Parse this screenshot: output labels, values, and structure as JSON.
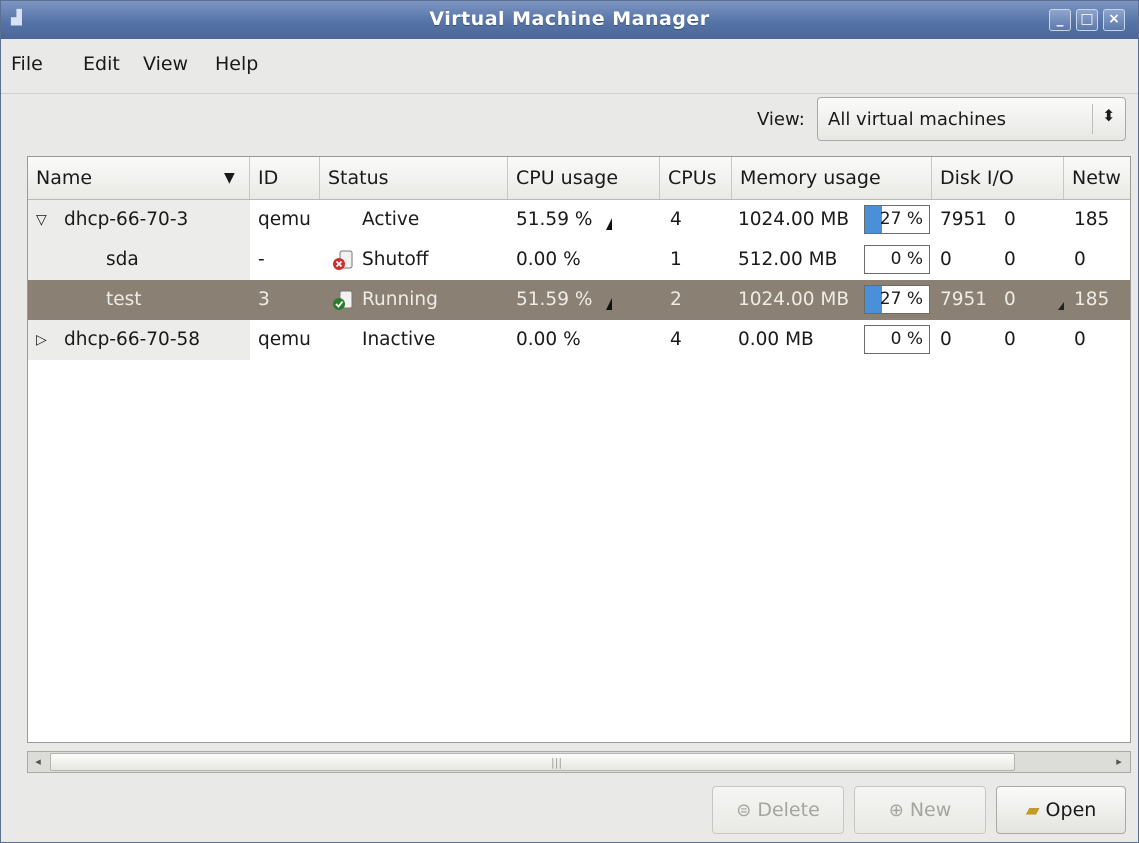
{
  "window": {
    "title": "Virtual Machine Manager",
    "app_icon": "vm-icon",
    "controls": [
      "minimize-icon",
      "maximize-icon",
      "close-icon"
    ]
  },
  "menu": {
    "items": [
      {
        "label": "File"
      },
      {
        "label": "Edit"
      },
      {
        "label": "View"
      },
      {
        "label": "Help"
      }
    ]
  },
  "view_filter": {
    "label": "View:",
    "selected": "All virtual machines",
    "arrow_icon": "up-down-arrows-icon"
  },
  "table": {
    "columns": [
      "Name",
      "ID",
      "Status",
      "CPU usage",
      "CPUs",
      "Memory usage",
      "Disk I/O",
      "Netw"
    ],
    "sort_icon": "sort-down-triangle-icon",
    "rows": [
      {
        "expander": "expanded",
        "name": "dhcp-66-70-3",
        "id": "qemu",
        "status": "Active",
        "status_icon": "",
        "cpu": "51.59 %",
        "cpus": "4",
        "memory": "1024.00 MB",
        "mem_pct_text": "27 %",
        "mem_fill": 0.27,
        "disk_read": "7951",
        "disk_write": "0",
        "net": "185",
        "selected": false
      },
      {
        "expander": "",
        "name": "sda",
        "id": "-",
        "status": "Shutoff",
        "status_icon": "vm-shutoff-icon",
        "cpu": "0.00 %",
        "cpus": "1",
        "memory": "512.00 MB",
        "mem_pct_text": "0 %",
        "mem_fill": 0,
        "disk_read": "0",
        "disk_write": "0",
        "net": "0",
        "selected": false
      },
      {
        "expander": "",
        "name": "test",
        "id": "3",
        "status": "Running",
        "status_icon": "vm-running-icon",
        "cpu": "51.59 %",
        "cpus": "2",
        "memory": "1024.00 MB",
        "mem_pct_text": "27 %",
        "mem_fill": 0.27,
        "disk_read": "7951",
        "disk_write": "0",
        "net": "185",
        "selected": true
      },
      {
        "expander": "collapsed",
        "name": "dhcp-66-70-58",
        "id": "qemu",
        "status": "Inactive",
        "status_icon": "",
        "cpu": "0.00 %",
        "cpus": "4",
        "memory": "0.00 MB",
        "mem_pct_text": "0 %",
        "mem_fill": 0,
        "disk_read": "0",
        "disk_write": "0",
        "net": "0",
        "selected": false
      }
    ]
  },
  "buttons": {
    "delete": {
      "label": "Delete",
      "icon": "delete-icon",
      "enabled": false
    },
    "new": {
      "label": "New",
      "icon": "new-vm-icon",
      "enabled": false
    },
    "open": {
      "label": "Open",
      "icon": "open-folder-icon",
      "enabled": true
    }
  }
}
